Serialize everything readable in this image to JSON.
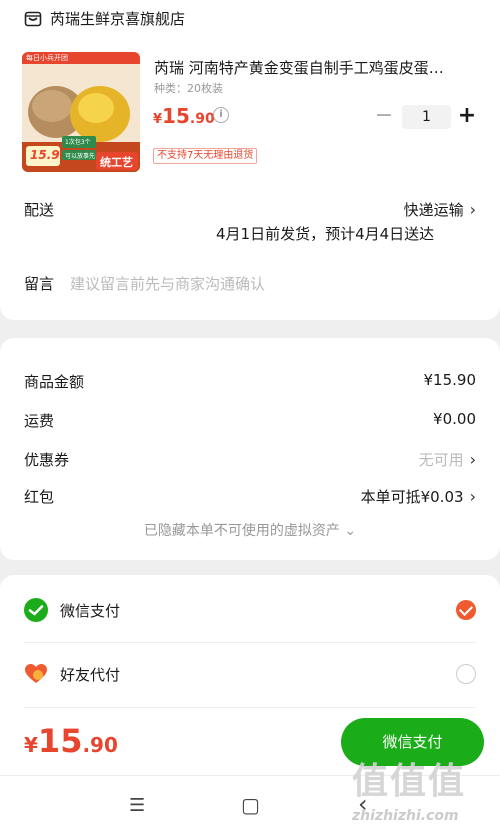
{
  "shop": {
    "name": "芮瑞生鲜京喜旗舰店",
    "icon": "store-icon"
  },
  "product": {
    "title": "芮瑞 河南特产黄金变蛋自制手工鸡蛋皮蛋…",
    "spec": "种类：20枚装",
    "price_currency": "¥",
    "price_int": "15",
    "price_dec": ".90",
    "quantity": "1",
    "minus": "−",
    "plus": "+",
    "no_return_badge": "不支持7天无理由退货",
    "thumb": {
      "top_badge": "每日小兵开团",
      "price_badge": "15.9",
      "side_badge_1": "1次包3个",
      "side_badge_2": "可以放事先",
      "craft_badge": "统工艺"
    }
  },
  "delivery": {
    "label": "配送",
    "method": "快递运输",
    "schedule": "4月1日前发货，预计4月4日送达"
  },
  "message": {
    "label": "留言",
    "placeholder": "建议留言前先与商家沟通确认"
  },
  "price_detail": {
    "rows": [
      {
        "label": "商品金额",
        "value": "¥15.90"
      },
      {
        "label": "运费",
        "value": "¥0.00"
      },
      {
        "label": "优惠券",
        "value": "无可用"
      },
      {
        "label": "红包",
        "value": "本单可抵¥0.03"
      }
    ],
    "hidden_assets": "已隐藏本单不可使用的虚拟资产",
    "hidden_assets_chevron": "⌄"
  },
  "payment": {
    "options": [
      {
        "label": "微信支付",
        "icon": "wechat-pay-icon",
        "selected": true
      },
      {
        "label": "好友代付",
        "icon": "friend-pay-heart-icon",
        "selected": false
      }
    ]
  },
  "footer": {
    "total_currency": "¥",
    "total_int": "15",
    "total_dec": ".90",
    "pay_button": "微信支付"
  },
  "system_nav": {
    "menu": "☰",
    "home": "▢",
    "back": "‹"
  },
  "watermark": {
    "text": "值值值",
    "url": "zhizhizhi.com"
  },
  "colors": {
    "accent": "#e8452e",
    "wechat_green": "#1aad19",
    "radio_selected": "#ef5a2e"
  }
}
